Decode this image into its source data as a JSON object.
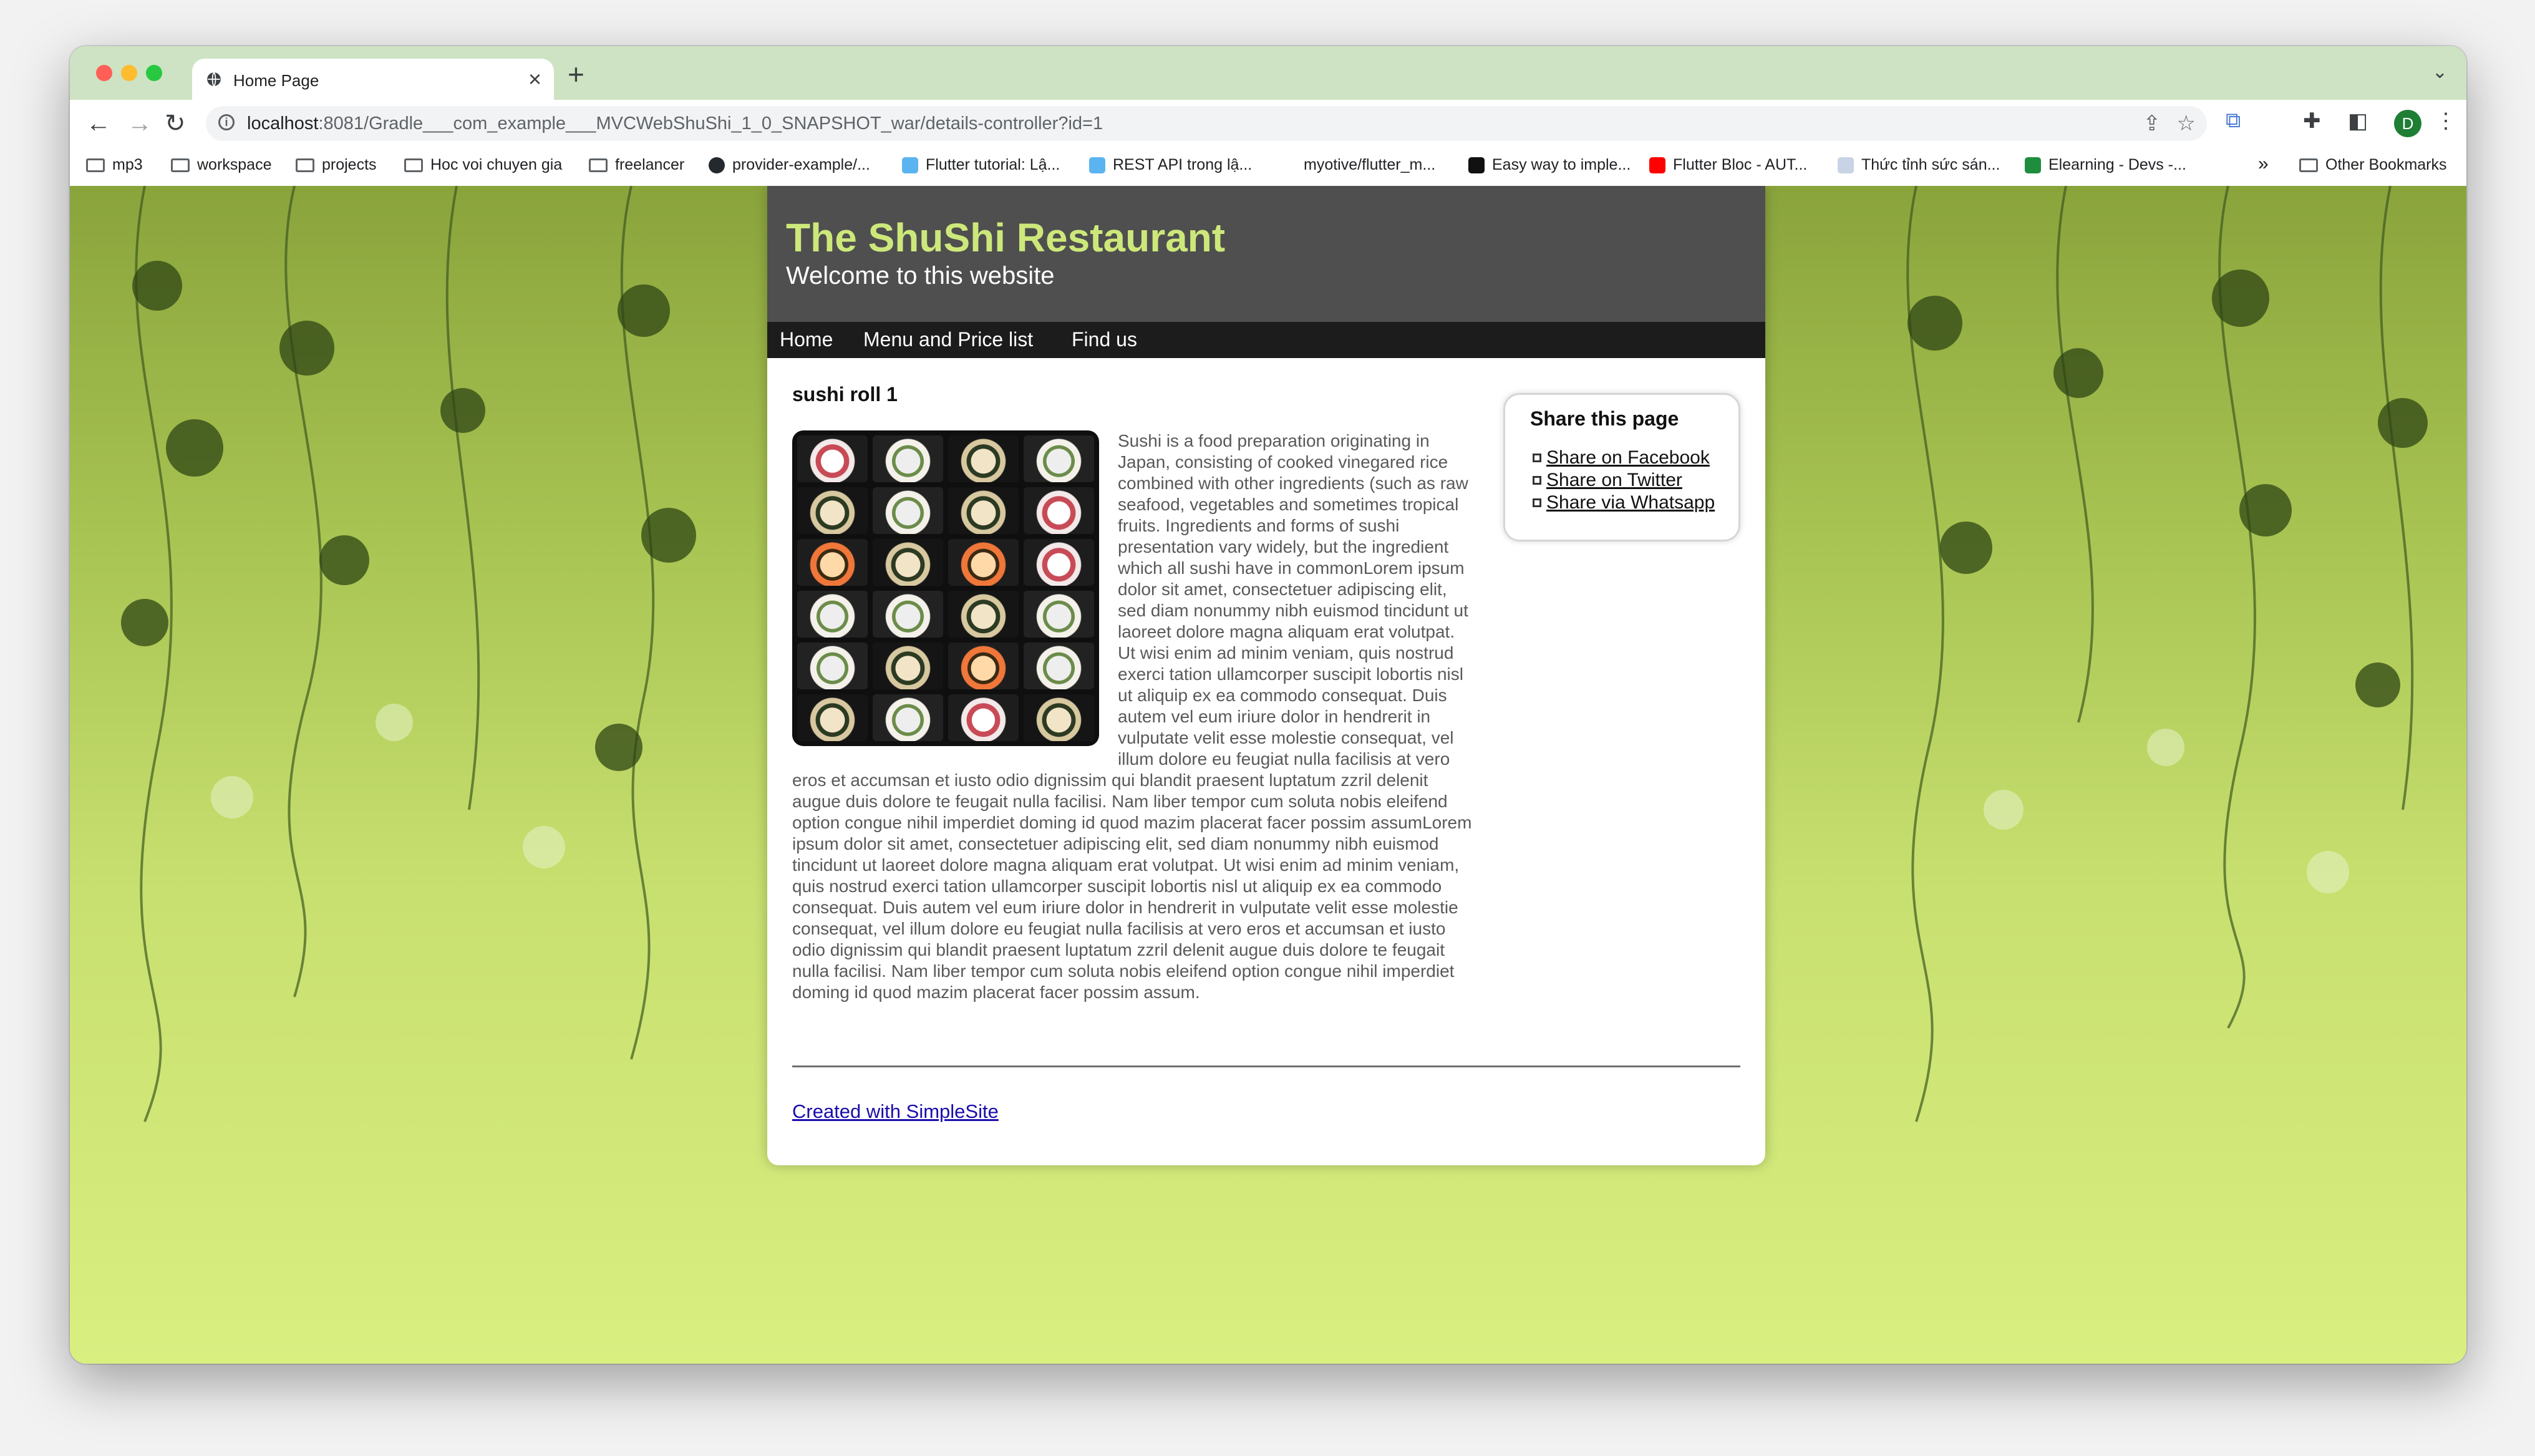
{
  "browser": {
    "tab_title": "Home Page",
    "tab_close": "×",
    "new_tab": "+",
    "tab_search": "⌄",
    "url_host": "localhost",
    "url_rest": ":8081/Gradle___com_example___MVCWebShuShi_1_0_SNAPSHOT_war/details-controller?id=1",
    "avatar_letter": "D",
    "bookmarks": [
      {
        "label": "mp3",
        "icon": "folder-icon"
      },
      {
        "label": "workspace",
        "icon": "folder-icon"
      },
      {
        "label": "projects",
        "icon": "folder-icon"
      },
      {
        "label": "Hoc voi chuyen gia",
        "icon": "folder-icon"
      },
      {
        "label": "freelancer",
        "icon": "folder-icon"
      },
      {
        "label": "provider-example/...",
        "icon": "github-icon"
      },
      {
        "label": "Flutter tutorial: Lậ...",
        "icon": "flutter-icon"
      },
      {
        "label": "REST API trong lậ...",
        "icon": "flutter-icon"
      },
      {
        "label": "myotive/flutter_m...",
        "icon": "page-icon"
      },
      {
        "label": "Easy way to imple...",
        "icon": "medium-icon"
      },
      {
        "label": "Flutter Bloc - AUT...",
        "icon": "youtube-icon"
      },
      {
        "label": "Thức tỉnh sức sán...",
        "icon": "image-icon"
      },
      {
        "label": "Elearning - Devs -...",
        "icon": "sheets-icon"
      }
    ],
    "bookmarks_overflow": "»",
    "other_bookmarks": "Other Bookmarks"
  },
  "site": {
    "title": "The ShuShi Restaurant",
    "subtitle": "Welcome to this website",
    "nav": [
      "Home",
      "Menu and Price list",
      "Find us"
    ],
    "heading": "sushi roll 1",
    "body": "Sushi is a food preparation originating in Japan, consisting of cooked vinegared rice combined with other ingredients (such as raw seafood, vegetables and sometimes tropical fruits. Ingredients and forms of sushi presentation vary widely, but the ingredient which all sushi have in commonLorem ipsum dolor sit amet, consectetuer adipiscing elit, sed diam nonummy nibh euismod tincidunt ut laoreet dolore magna aliquam erat volutpat. Ut wisi enim ad minim veniam, quis nostrud exerci tation ullamcorper suscipit lobortis nisl ut aliquip ex ea commodo consequat. Duis autem vel eum iriure dolor in hendrerit in vulputate velit esse molestie consequat, vel illum dolore eu feugiat nulla facilisis at vero eros et accumsan et iusto odio dignissim qui blandit praesent luptatum zzril delenit augue duis dolore te feugait nulla facilisi. Nam liber tempor cum soluta nobis eleifend option congue nihil imperdiet doming id quod mazim placerat facer possim assumLorem ipsum dolor sit amet, consectetuer adipiscing elit, sed diam nonummy nibh euismod tincidunt ut laoreet dolore magna aliquam erat volutpat. Ut wisi enim ad minim veniam, quis nostrud exerci tation ullamcorper suscipit lobortis nisl ut aliquip ex ea commodo consequat. Duis autem vel eum iriure dolor in hendrerit in vulputate velit esse molestie consequat, vel illum dolore eu feugiat nulla facilisis at vero eros et accumsan et iusto odio dignissim qui blandit praesent luptatum zzril delenit augue duis dolore te feugait nulla facilisi. Nam liber tempor cum soluta nobis eleifend option congue nihil imperdiet doming id quod mazim placerat facer possim assum.",
    "share": {
      "title": "Share this page",
      "facebook": "Share on Facebook",
      "twitter": "Share on Twitter",
      "whatsapp": "Share via Whatsapp"
    },
    "footer_link": "Created with SimpleSite"
  },
  "colors": {
    "header_bg": "#4f4f4f",
    "title_green": "#cde87a",
    "nav_bg": "#1c1c1c",
    "link_blue": "#1a0dab"
  }
}
